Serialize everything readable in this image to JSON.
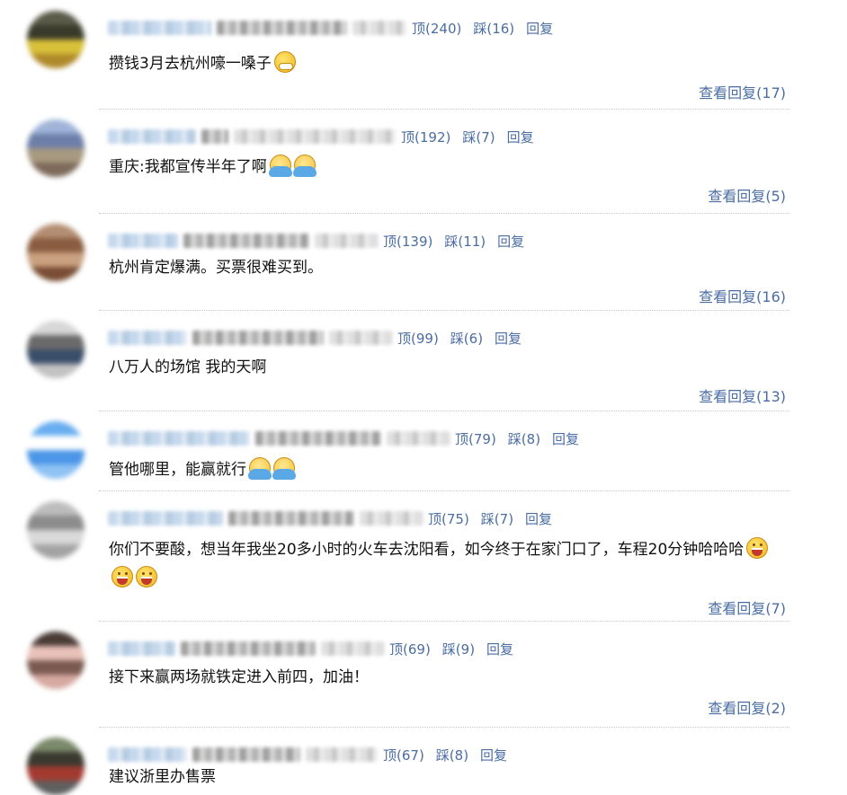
{
  "comments": [
    {
      "text": "攒钱3月去杭州嚎一嗓子",
      "emojis": [
        "cry"
      ],
      "actions": {
        "up": "顶(240)",
        "down": "踩(16)",
        "reply": "回复"
      },
      "replies": "查看回复(17)",
      "avatar_colors": [
        "#5b5b4a",
        "#3a3a2a",
        "#d8c03a",
        "#b08a2a"
      ]
    },
    {
      "text": "重庆:我都宣传半年了啊",
      "emojis": [
        "pray",
        "pray"
      ],
      "actions": {
        "up": "顶(192)",
        "down": "踩(7)",
        "reply": "回复"
      },
      "replies": "查看回复(5)",
      "avatar_colors": [
        "#9fb4d8",
        "#6d7fa8",
        "#a89a80",
        "#7d6a5a"
      ]
    },
    {
      "text": "杭州肯定爆满。买票很难买到。",
      "emojis": [],
      "actions": {
        "up": "顶(139)",
        "down": "踩(11)",
        "reply": "回复"
      },
      "replies": "查看回复(16)",
      "avatar_colors": [
        "#b48e72",
        "#8a5c40",
        "#c9a180",
        "#7a4e35"
      ]
    },
    {
      "text": "八万人的场馆 我的天啊",
      "emojis": [],
      "actions": {
        "up": "顶(99)",
        "down": "踩(6)",
        "reply": "回复"
      },
      "replies": "查看回复(13)",
      "avatar_colors": [
        "#d7d7d7",
        "#6a6a6a",
        "#3a4e6a",
        "#c2c2c2"
      ]
    },
    {
      "text": "管他哪里，能赢就行",
      "emojis": [
        "pray",
        "pray"
      ],
      "actions": {
        "up": "顶(79)",
        "down": "踩(8)",
        "reply": "回复"
      },
      "replies": "",
      "avatar_colors": [
        "#68aef0",
        "#ffffff",
        "#4b96e6",
        "#8fc2f4"
      ]
    },
    {
      "text": "你们不要酸，想当年我坐20多小时的火车去沈阳看，如今终于在家门口了，车程20分钟哈哈哈",
      "emojis": [
        "grin",
        "grin",
        "grin"
      ],
      "actions": {
        "up": "顶(75)",
        "down": "踩(7)",
        "reply": "回复"
      },
      "replies": "查看回复(7)",
      "avatar_colors": [
        "#bdbdbd",
        "#8c8c8c",
        "#d9d9d9",
        "#a3a3a3"
      ]
    },
    {
      "text": "接下来赢两场就铁定进入前四，加油！",
      "emojis": [],
      "actions": {
        "up": "顶(69)",
        "down": "踩(9)",
        "reply": "回复"
      },
      "replies": "查看回复(2)",
      "avatar_colors": [
        "#4a3a35",
        "#e8c2b8",
        "#7a5a50",
        "#d6a9a0"
      ]
    },
    {
      "text": "建议浙里办售票",
      "emojis": [],
      "actions": {
        "up": "顶(67)",
        "down": "踩(8)",
        "reply": "回复"
      },
      "replies": "",
      "avatar_colors": [
        "#7a8a6a",
        "#3a3a30",
        "#a33a30",
        "#606060"
      ]
    }
  ]
}
